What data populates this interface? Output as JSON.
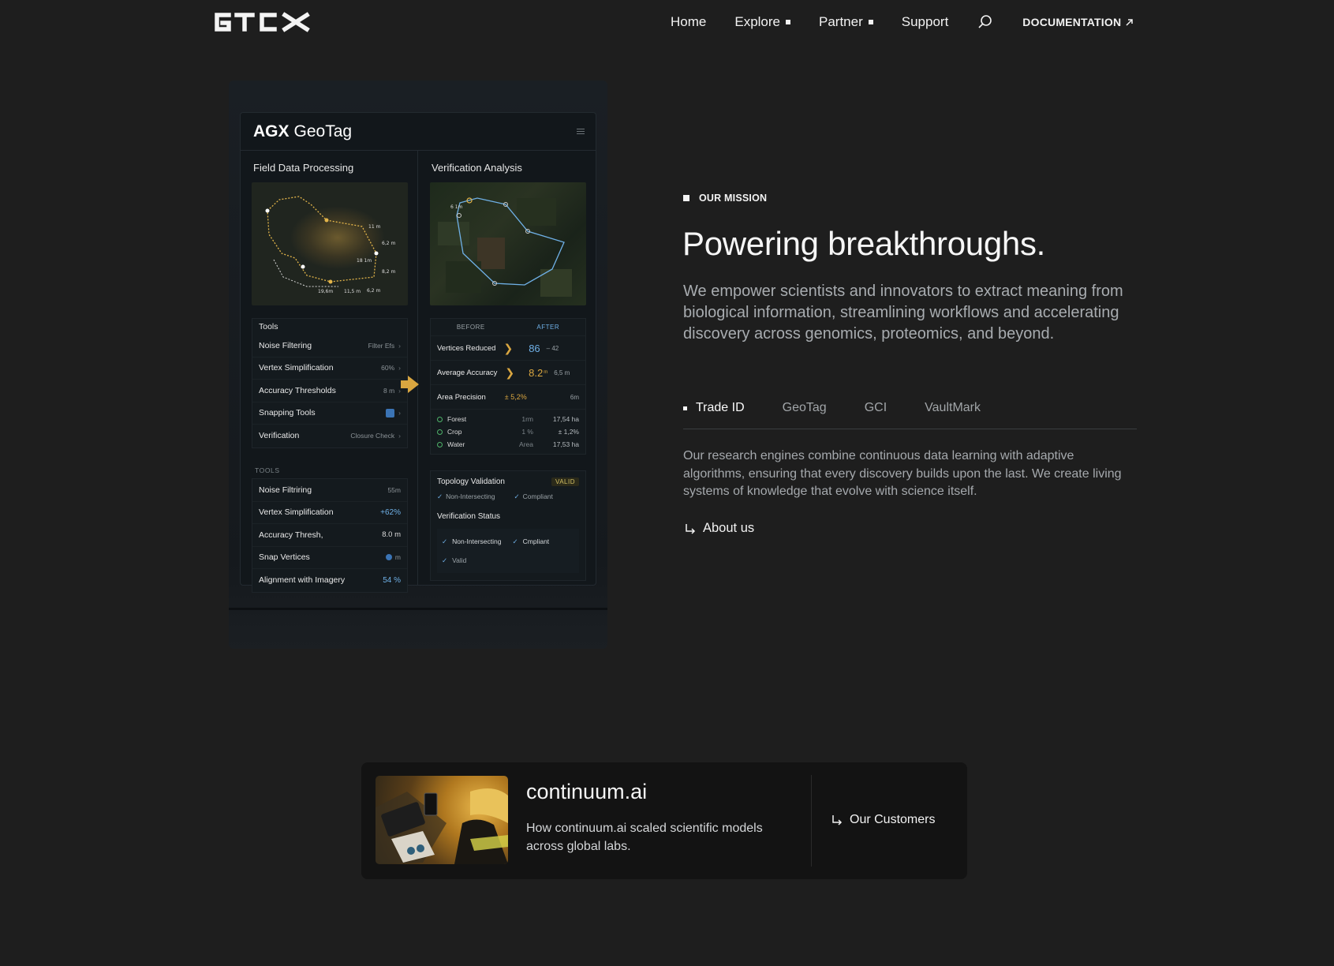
{
  "nav": {
    "logo": "GTCX",
    "links": [
      {
        "label": "Home",
        "has_marker": false
      },
      {
        "label": "Explore",
        "has_marker": true
      },
      {
        "label": "Partner",
        "has_marker": true
      },
      {
        "label": "Support",
        "has_marker": false
      }
    ],
    "search_icon": "search-icon",
    "documentation_label": "DOCUMENTATION"
  },
  "panel": {
    "app_brand": "AGX",
    "app_name": "GeoTag",
    "left_heading": "Field Data Processing",
    "right_heading": "Verification Analysis",
    "map_left_labels": [
      "11 m",
      "6,2 m",
      "18 1m",
      "8,2 m",
      "19,6m",
      "11,5 m",
      "6,2 m"
    ],
    "map_right_label": "6 1m",
    "tools_heading": "Tools",
    "tools": [
      {
        "label": "Noise Filtering",
        "value": "Filter Efs"
      },
      {
        "label": "Vertex Simplification",
        "value": "60%"
      },
      {
        "label": "Accuracy Thresholds",
        "value": "8 m"
      },
      {
        "label": "Snapping Tools",
        "value": ""
      },
      {
        "label": "Verification",
        "value": "Closure Check"
      }
    ],
    "tools2_heading": "TOOLS",
    "tools2": [
      {
        "label": "Noise Filtriring",
        "value": "55m"
      },
      {
        "label": "Vertex Simplification",
        "value": "+62%"
      },
      {
        "label": "Accuracy Thresh,",
        "value": "8.0 m"
      },
      {
        "label": "Snap Vertices",
        "value": "m"
      },
      {
        "label": "Alignment with Imagery",
        "value": "54 %"
      }
    ],
    "before_label": "BEFORE",
    "after_label": "AFTER",
    "metrics": [
      {
        "label": "Vertices Reduced",
        "value": "86",
        "sub": "– 42"
      },
      {
        "label": "Average Accuracy",
        "value": "8.2",
        "unit": "m",
        "sub": "6,5 m"
      },
      {
        "label": "Area Precision",
        "value": "± 5,2%",
        "sub": "6m"
      }
    ],
    "land": [
      {
        "label": "Forest",
        "mid": "1rm",
        "value": "17,54 ha"
      },
      {
        "label": "Crop",
        "mid": "1 %",
        "value": "± 1,2%"
      },
      {
        "label": "Water",
        "mid": "Area",
        "value": "17,53 ha"
      }
    ],
    "topology_label": "Topology Validation",
    "topology_badge": "VALID",
    "topology_checks": [
      "Non-Intersecting",
      "Compliant"
    ],
    "status_label": "Verification Status",
    "status_checks": [
      "Non-Intersecting",
      "Cmpliant",
      "Valid"
    ]
  },
  "mission": {
    "label": "OUR MISSION",
    "headline": "Powering breakthroughs.",
    "intro": "We empower scientists and innovators to extract meaning from biological information, streamlining workflows and accelerating discovery across genomics, proteomics, and beyond."
  },
  "tabs": [
    {
      "label": "Trade ID",
      "active": true
    },
    {
      "label": "GeoTag",
      "active": false
    },
    {
      "label": "GCI",
      "active": false
    },
    {
      "label": "VaultMark",
      "active": false
    }
  ],
  "tab_body": "Our research engines combine continuous data learning with adaptive algorithms, ensuring that every discovery builds upon the last. We create living systems of knowledge that evolve with science itself.",
  "about_label": "About us",
  "card": {
    "title": "continuum.ai",
    "description": "How continuum.ai scaled scientific models across global labs.",
    "link_label": "Our Customers"
  }
}
